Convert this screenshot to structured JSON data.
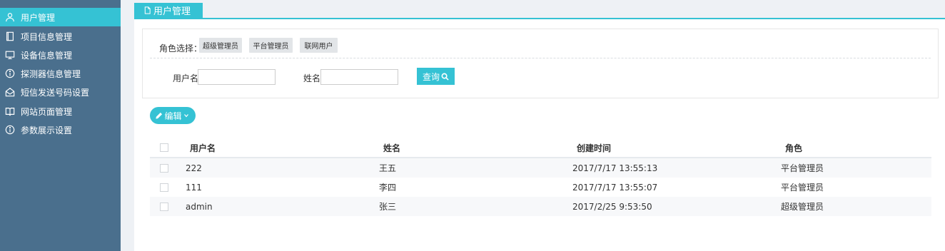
{
  "sidebar": {
    "items": [
      {
        "label": "用户管理",
        "icon": "user-icon",
        "active": true
      },
      {
        "label": "项目信息管理",
        "icon": "book-icon",
        "active": false
      },
      {
        "label": "设备信息管理",
        "icon": "monitor-icon",
        "active": false
      },
      {
        "label": "探测器信息管理",
        "icon": "info-icon",
        "active": false
      },
      {
        "label": "短信发送号码设置",
        "icon": "envelope-open-icon",
        "active": false
      },
      {
        "label": "网站页面管理",
        "icon": "open-book-icon",
        "active": false
      },
      {
        "label": "参数展示设置",
        "icon": "info-icon",
        "active": false
      }
    ]
  },
  "tab": {
    "label": "用户管理",
    "icon": "file-icon"
  },
  "filter": {
    "role_label": "角色选择：",
    "roles": [
      "超级管理员",
      "平台管理员",
      "联网用户"
    ],
    "username_label": "用户名",
    "username_value": "",
    "name_label": "姓名",
    "name_value": "",
    "query_label": "查询"
  },
  "edit_button": {
    "label": "编辑"
  },
  "table": {
    "headers": [
      "用户名",
      "姓名",
      "创建时间",
      "角色"
    ],
    "rows": [
      [
        "222",
        "王五",
        "2017/7/17 13:55:13",
        "平台管理员"
      ],
      [
        "111",
        "李四",
        "2017/7/17 13:55:07",
        "平台管理员"
      ],
      [
        "admin",
        "张三",
        "2017/2/25 9:53:50",
        "超级管理员"
      ]
    ]
  },
  "colors": {
    "accent": "#35c2d4",
    "sidebar": "#4a6f8d"
  }
}
